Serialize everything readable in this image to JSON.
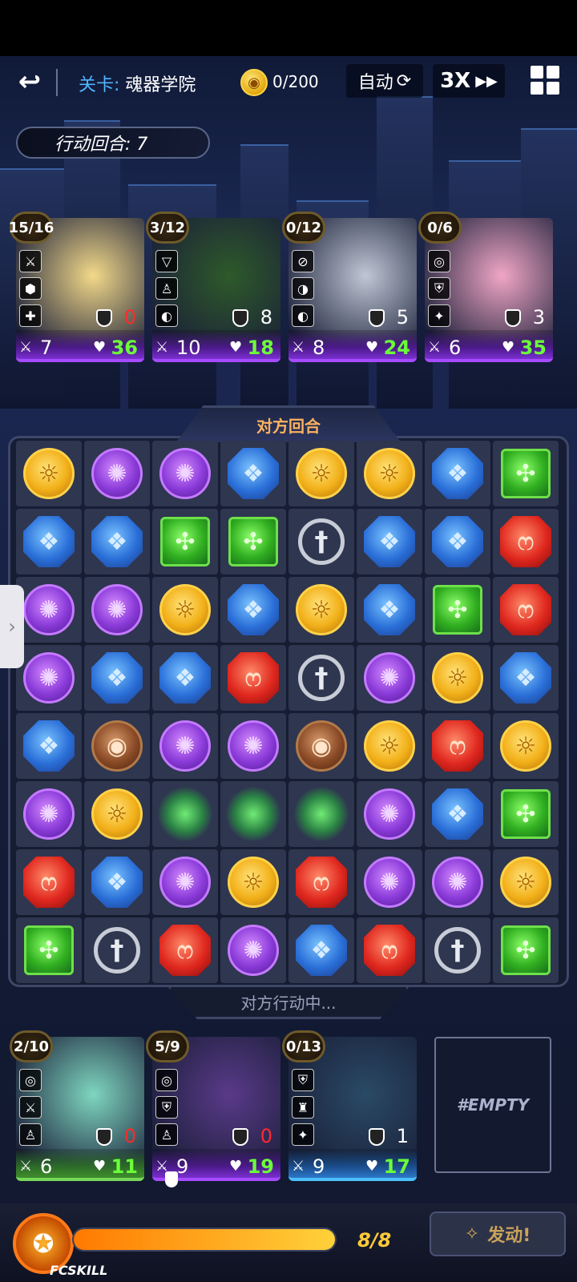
{
  "topbar": {
    "back_icon": "back-arrow-icon",
    "stage_label": "关卡:",
    "stage_name": "魂器学院",
    "coin_count": "0/200",
    "auto_label": "自动",
    "speed_label": "3X",
    "menu_icon": "grid-menu-icon"
  },
  "turn_counter": "行动回合: 7",
  "enemy_cards": [
    {
      "energy": "15/16",
      "defense": "0",
      "attack": "7",
      "hp": "36",
      "color": "purple",
      "skills": [
        "⚔",
        "⬢",
        "✚"
      ]
    },
    {
      "energy": "3/12",
      "defense": "8",
      "attack": "10",
      "hp": "18",
      "color": "purple",
      "skills": [
        "▽",
        "♙",
        "◐"
      ]
    },
    {
      "energy": "0/12",
      "defense": "5",
      "attack": "8",
      "hp": "24",
      "color": "purple",
      "skills": [
        "⊘",
        "◑",
        "◐"
      ]
    },
    {
      "energy": "0/6",
      "defense": "3",
      "attack": "6",
      "hp": "35",
      "color": "purple",
      "skills": [
        "◎",
        "⛨",
        "✦"
      ]
    }
  ],
  "board": {
    "title": "对方回合",
    "status": "对方行动中...",
    "rows": [
      [
        "sun",
        "purple",
        "purple",
        "blue",
        "sun",
        "sun",
        "blue",
        "green"
      ],
      [
        "blue",
        "blue",
        "green",
        "green",
        "sword",
        "blue",
        "blue",
        "red"
      ],
      [
        "purple",
        "purple",
        "sun",
        "blue",
        "sun",
        "blue",
        "green",
        "red"
      ],
      [
        "purple",
        "blue",
        "blue",
        "red",
        "sword",
        "purple",
        "sun",
        "blue"
      ],
      [
        "blue",
        "brown",
        "purple",
        "purple",
        "brown",
        "sun",
        "red",
        "sun"
      ],
      [
        "purple",
        "sun",
        "toxic",
        "toxic",
        "toxic",
        "purple",
        "blue",
        "green"
      ],
      [
        "red",
        "blue",
        "purple",
        "sun",
        "red",
        "purple",
        "purple",
        "sun"
      ],
      [
        "green",
        "sword",
        "red",
        "purple",
        "blue",
        "red",
        "sword",
        "green"
      ]
    ]
  },
  "player_cards": [
    {
      "energy": "2/10",
      "defense": "0",
      "attack": "6",
      "hp": "11",
      "color": "green",
      "skills": [
        "◎",
        "⚔",
        "♙"
      ]
    },
    {
      "energy": "5/9",
      "defense": "0",
      "attack": "9",
      "hp": "19",
      "color": "purple",
      "skills": [
        "◎",
        "⛨",
        "♙"
      ]
    },
    {
      "energy": "0/13",
      "defense": "1",
      "attack": "9",
      "hp": "17",
      "color": "blue",
      "skills": [
        "⛨",
        "♜",
        "✦"
      ]
    }
  ],
  "empty_slot": "#EMPTY",
  "fcskill": {
    "label": "FCSKILL",
    "count": "8/8",
    "fill_fraction": 1.0,
    "fire_label": "发动!"
  }
}
